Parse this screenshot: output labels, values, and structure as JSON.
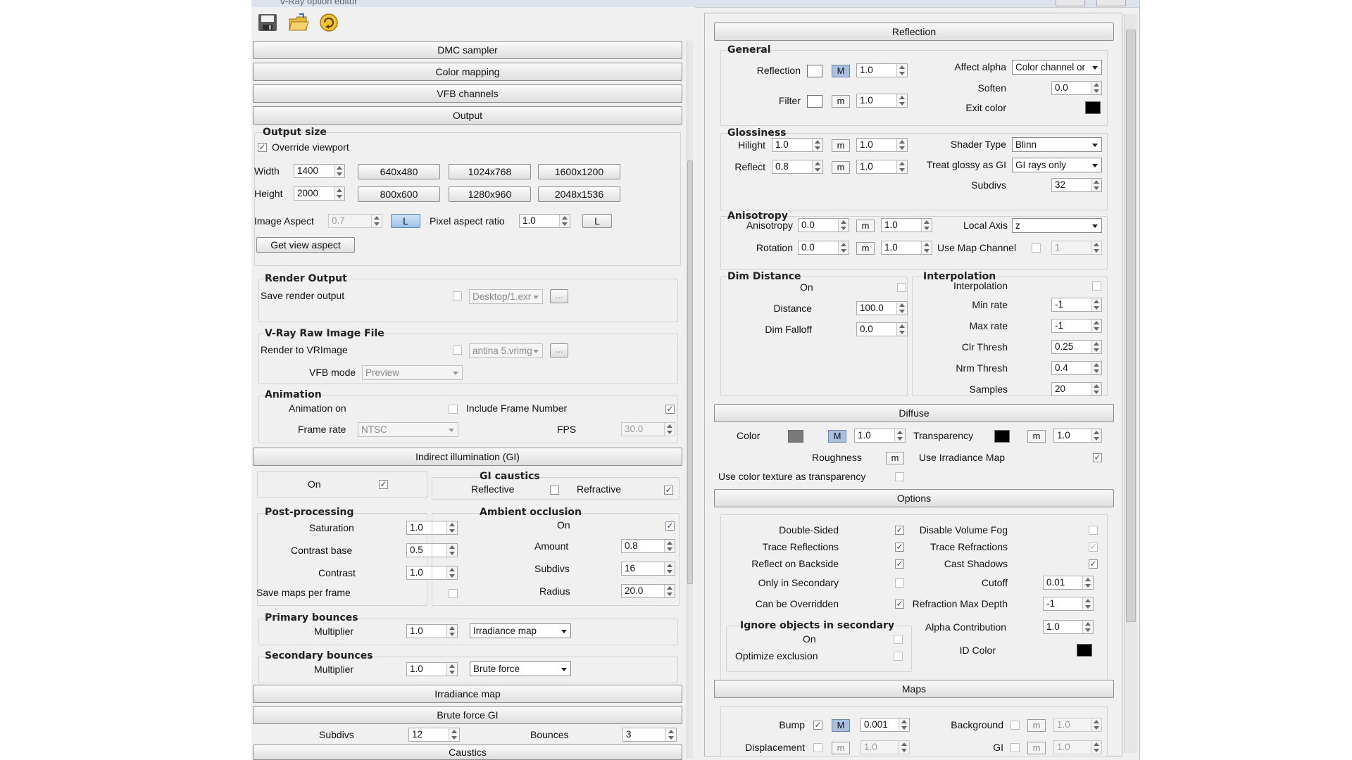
{
  "window": {
    "title": "V-Ray option editor"
  },
  "toolbar": {
    "icons": [
      "save-icon",
      "open-folder-icon",
      "refresh-icon"
    ]
  },
  "left": {
    "rollouts": {
      "dmc": "DMC sampler",
      "color_mapping": "Color mapping",
      "vfb_channels": "VFB channels",
      "output": "Output",
      "gi": "Indirect illumination (GI)",
      "irradiance": "Irradiance map",
      "brute": "Brute force GI",
      "caustics": "Caustics"
    },
    "output_size": {
      "title": "Output size",
      "override": "Override viewport",
      "width_label": "Width",
      "width": "1400",
      "height_label": "Height",
      "height": "2000",
      "presets": [
        "640x480",
        "1024x768",
        "1600x1200",
        "800x600",
        "1280x960",
        "2048x1536"
      ],
      "image_aspect_label": "Image Aspect",
      "image_aspect": "0.7",
      "lock": "L",
      "pixel_aspect_label": "Pixel aspect ratio",
      "pixel_aspect": "1.0",
      "lock2": "L",
      "get_view_aspect": "Get view aspect"
    },
    "render_output": {
      "title": "Render Output",
      "save_label": "Save render output",
      "path": "Desktop/1.exr",
      "browse": "..."
    },
    "vrimg": {
      "title": "V-Ray Raw Image File",
      "render_label": "Render to VRImage",
      "path": "antina 5.vrimg",
      "browse": "...",
      "vfb_mode_label": "VFB mode",
      "vfb_mode": "Preview"
    },
    "animation": {
      "title": "Animation",
      "on_label": "Animation on",
      "include_frame": "Include Frame Number",
      "frame_rate_label": "Frame rate",
      "frame_rate": "NTSC",
      "fps_label": "FPS",
      "fps": "30.0"
    },
    "gi": {
      "on_label": "On",
      "caustics_title": "GI caustics",
      "reflective": "Reflective",
      "refractive": "Refractive",
      "post_title": "Post-processing",
      "saturation_label": "Saturation",
      "saturation": "1.0",
      "contrast_base_label": "Contrast base",
      "contrast_base": "0.5",
      "contrast_label": "Contrast",
      "contrast": "1.0",
      "save_maps": "Save maps per frame",
      "ao_title": "Ambient occlusion",
      "ao_on": "On",
      "amount_label": "Amount",
      "amount": "0.8",
      "subdivs_label": "Subdivs",
      "subdivs": "16",
      "radius_label": "Radius",
      "radius": "20.0",
      "primary_title": "Primary bounces",
      "primary_mult_label": "Multiplier",
      "primary_mult": "1.0",
      "primary_engine": "Irradiance map",
      "secondary_title": "Secondary bounces",
      "secondary_mult_label": "Multiplier",
      "secondary_mult": "1.0",
      "secondary_engine": "Brute force"
    },
    "brute": {
      "subdivs_label": "Subdivs",
      "subdivs": "12",
      "bounces_label": "Bounces",
      "bounces": "3"
    }
  },
  "right": {
    "rollouts": {
      "reflection": "Reflection",
      "diffuse": "Diffuse",
      "options": "Options",
      "maps": "Maps"
    },
    "general": {
      "title": "General",
      "reflection_label": "Reflection",
      "reflection_m": "M",
      "reflection_val": "1.0",
      "filter_label": "Filter",
      "filter_m": "m",
      "filter_val": "1.0",
      "affect_alpha_label": "Affect alpha",
      "affect_alpha": "Color channel or",
      "soften_label": "Soften",
      "soften": "0.0",
      "exit_color_label": "Exit color"
    },
    "glossiness": {
      "title": "Glossiness",
      "hilight_label": "Hilight",
      "hilight": "1.0",
      "hilight_m": "m",
      "hilight_map": "1.0",
      "reflect_label": "Reflect",
      "reflect": "0.8",
      "reflect_m": "m",
      "reflect_map": "1.0",
      "shader_type_label": "Shader Type",
      "shader_type": "Blinn",
      "glossy_gi_label": "Treat glossy as GI",
      "glossy_gi": "GI rays only",
      "subdivs_label": "Subdivs",
      "subdivs": "32"
    },
    "anisotropy": {
      "title": "Anisotropy",
      "aniso_label": "Anisotropy",
      "aniso": "0.0",
      "aniso_m": "m",
      "aniso_map": "1.0",
      "rotation_label": "Rotation",
      "rotation": "0.0",
      "rotation_m": "m",
      "rotation_map": "1.0",
      "local_axis_label": "Local Axis",
      "local_axis": "z",
      "use_map_channel": "Use Map Channel",
      "map_channel": "1"
    },
    "dim": {
      "title": "Dim Distance",
      "on_label": "On",
      "distance_label": "Distance",
      "distance": "100.0",
      "falloff_label": "Dim Falloff",
      "falloff": "0.0"
    },
    "interp": {
      "title": "Interpolation",
      "interp_label": "Interpolation",
      "min_rate_label": "Min rate",
      "min_rate": "-1",
      "max_rate_label": "Max rate",
      "max_rate": "-1",
      "clr_label": "Clr Thresh",
      "clr": "0.25",
      "nrm_label": "Nrm Thresh",
      "nrm": "0.4",
      "samples_label": "Samples",
      "samples": "20"
    },
    "diffuse": {
      "color_label": "Color",
      "color_m": "M",
      "color_val": "1.0",
      "transparency_label": "Transparency",
      "transparency_m": "m",
      "transparency_val": "1.0",
      "roughness_label": "Roughness",
      "roughness_m": "m",
      "irradiance_map": "Use Irradiance Map",
      "color_tex": "Use color texture as transparency"
    },
    "options": {
      "double_sided": "Double-Sided",
      "trace_refl": "Trace Reflections",
      "reflect_backside": "Reflect on Backside",
      "only_secondary": "Only in Secondary",
      "overridden": "Can be Overridden",
      "disable_fog": "Disable Volume Fog",
      "trace_refr": "Trace Refractions",
      "cast_shadows": "Cast Shadows",
      "cutoff_label": "Cutoff",
      "cutoff": "0.01",
      "refr_depth_label": "Refraction Max Depth",
      "refr_depth": "-1",
      "alpha_label": "Alpha Contribution",
      "alpha": "1.0",
      "id_color_label": "ID Color",
      "ignore_title": "Ignore objects in secondary",
      "ignore_on": "On",
      "optimize": "Optimize exclusion"
    },
    "maps": {
      "bump_label": "Bump",
      "bump_m": "M",
      "bump_val": "0.001",
      "background_label": "Background",
      "background_m": "m",
      "background_val": "1.0",
      "displacement_label": "Displacement",
      "displacement_m": "m",
      "displacement_val": "1.0",
      "gi_label": "GI",
      "gi_m": "m",
      "gi_val": "1.0"
    }
  },
  "colors": {
    "diffuse_color": "#7a7a7a",
    "black": "#000000",
    "white": "#ffffff"
  }
}
